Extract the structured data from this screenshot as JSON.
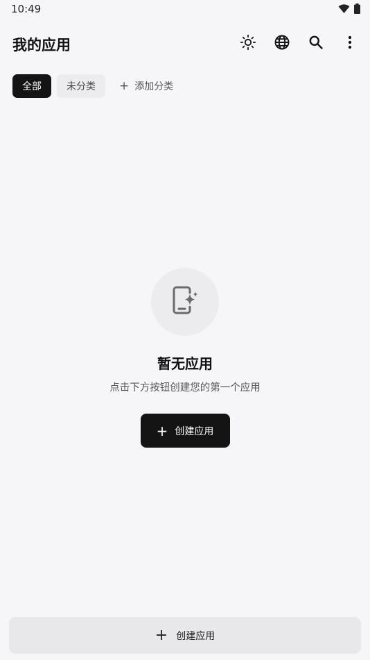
{
  "status_bar": {
    "time": "10:49",
    "icons": [
      "wifi-icon",
      "battery-icon"
    ]
  },
  "app_bar": {
    "title": "我的应用",
    "actions": [
      "brightness-icon",
      "globe-icon",
      "search-icon",
      "more-vert-icon"
    ]
  },
  "filters": {
    "all_label": "全部",
    "uncategorized_label": "未分类",
    "add_category_label": "添加分类",
    "add_icon": "+"
  },
  "empty_state": {
    "icon": "app-sparkle-icon",
    "title": "暂无应用",
    "subtitle": "点击下方按钮创建您的第一个应用",
    "button_label": "创建应用",
    "button_icon": "+"
  },
  "bottom_bar": {
    "button_label": "创建应用",
    "button_icon": "+"
  },
  "colors": {
    "background": "#f6f6f8",
    "primary": "#141414",
    "chip_idle": "#ececee",
    "bottom_button": "#e8e8ea"
  }
}
